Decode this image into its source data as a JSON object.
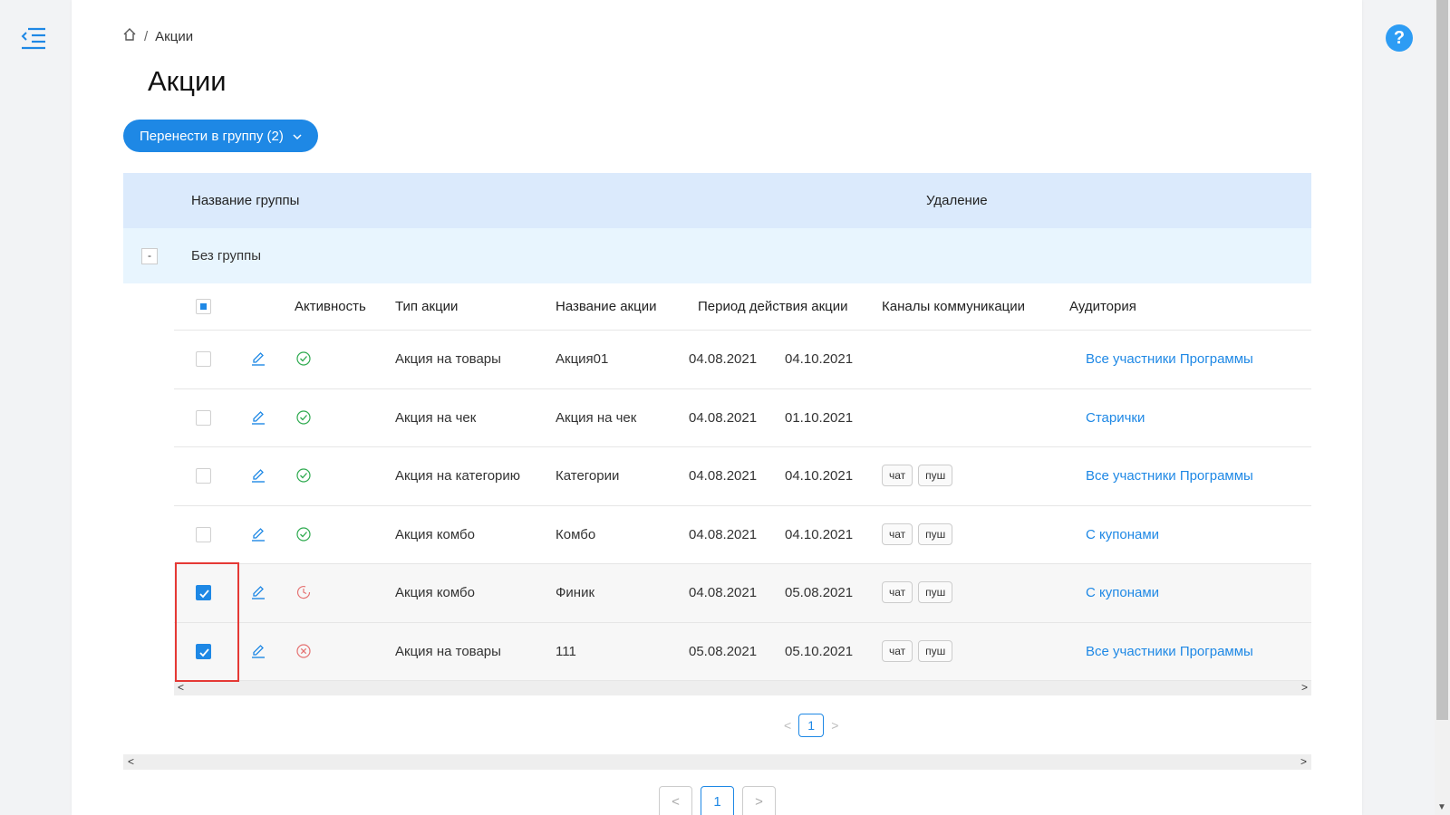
{
  "breadcrumb": {
    "current": "Акции"
  },
  "page_title": "Акции",
  "move_button": {
    "label": "Перенести в группу (2)"
  },
  "group_table": {
    "headers": {
      "name": "Название группы",
      "delete": "Удаление"
    },
    "group": {
      "collapse_label": "-",
      "name": "Без группы"
    }
  },
  "promo_table": {
    "headers": {
      "activity": "Активность",
      "type": "Тип акции",
      "name": "Название акции",
      "period": "Период действия акции",
      "channels": "Каналы коммуникации",
      "audience": "Аудитория"
    },
    "rows": [
      {
        "selected": false,
        "status": "active",
        "type": "Акция на товары",
        "name": "Акция01",
        "start": "04.08.2021",
        "end": "04.10.2021",
        "channels": [],
        "audience": "Все участники Программы"
      },
      {
        "selected": false,
        "status": "active",
        "type": "Акция на чек",
        "name": "Акция на чек",
        "start": "04.08.2021",
        "end": "01.10.2021",
        "channels": [],
        "audience": "Старички"
      },
      {
        "selected": false,
        "status": "active",
        "type": "Акция на категорию",
        "name": "Категории",
        "start": "04.08.2021",
        "end": "04.10.2021",
        "channels": [
          "чат",
          "пуш"
        ],
        "audience": "Все участники Программы"
      },
      {
        "selected": false,
        "status": "active",
        "type": "Акция комбо",
        "name": "Комбо",
        "start": "04.08.2021",
        "end": "04.10.2021",
        "channels": [
          "чат",
          "пуш"
        ],
        "audience": "С купонами"
      },
      {
        "selected": true,
        "status": "pending",
        "type": "Акция комбо",
        "name": "Финик",
        "start": "04.08.2021",
        "end": "05.08.2021",
        "channels": [
          "чат",
          "пуш"
        ],
        "audience": "С купонами"
      },
      {
        "selected": true,
        "status": "inactive",
        "type": "Акция на товары",
        "name": "111",
        "start": "05.08.2021",
        "end": "05.10.2021",
        "channels": [
          "чат",
          "пуш"
        ],
        "audience": "Все участники Программы"
      }
    ]
  },
  "pagination": {
    "inner_page": "1",
    "outer_page": "1",
    "prev": "<",
    "next": ">"
  },
  "help": {
    "label": "?"
  },
  "colors": {
    "accent": "#1e88e5",
    "active": "#2eaa4f",
    "inactive": "#e57373",
    "header_bg": "#dbeafc",
    "group_bg": "#e8f5fe"
  },
  "icons": {
    "menu": "menu-collapse-icon",
    "home": "home-icon",
    "edit": "pencil-icon",
    "active": "check-circle-icon",
    "pending": "clock-icon",
    "inactive": "x-circle-icon",
    "dropdown": "chevron-down-icon"
  }
}
